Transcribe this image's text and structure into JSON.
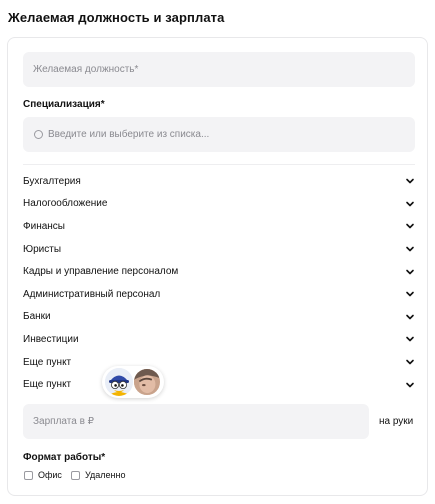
{
  "page_title": "Желаемая должность и зарплата",
  "position": {
    "placeholder": "Желаемая должность*"
  },
  "specialization": {
    "label": "Специализация*",
    "search_placeholder": "Введите или выберите из списка...",
    "items": [
      {
        "label": "Бухгалтерия"
      },
      {
        "label": "Налогообложение"
      },
      {
        "label": "Финансы"
      },
      {
        "label": "Юристы"
      },
      {
        "label": "Кадры и управление персоналом"
      },
      {
        "label": "Административный персонал"
      },
      {
        "label": "Банки"
      },
      {
        "label": "Инвестиции"
      },
      {
        "label": "Еще пункт"
      },
      {
        "label": "Еще пункт"
      }
    ]
  },
  "salary": {
    "placeholder": "Зарплата в ₽",
    "suffix": "на руки"
  },
  "work_format": {
    "label": "Формат работы*",
    "options": [
      {
        "label": "Офис",
        "checked": false
      },
      {
        "label": "Удаленно",
        "checked": false
      }
    ]
  },
  "icons": {
    "search": "search-icon",
    "chevron": "chevron-down-icon",
    "checkbox": "checkbox-icon"
  },
  "colors": {
    "field_bg": "#f3f3f5",
    "border": "#e8e8ea",
    "placeholder": "#8a8a90",
    "text": "#111111"
  }
}
